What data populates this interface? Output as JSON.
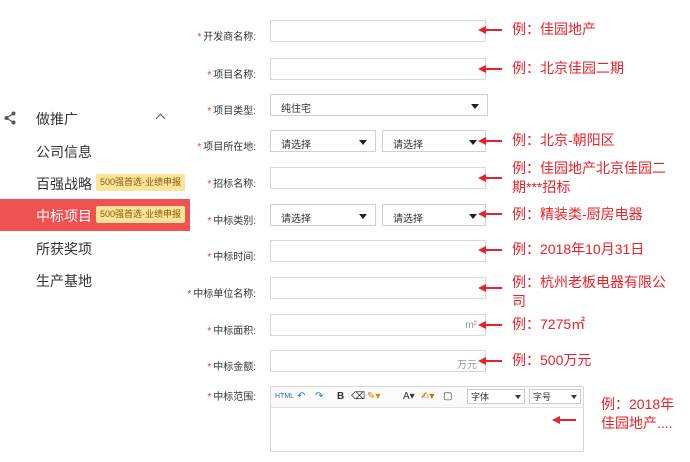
{
  "sidebar": {
    "title": "做推广",
    "items": [
      {
        "label": "公司信息",
        "badge": ""
      },
      {
        "label": "百强战略",
        "badge": "500强首选·业绩申报"
      },
      {
        "label": "中标项目",
        "badge": "500强首选·业绩申报"
      },
      {
        "label": "所获奖项",
        "badge": ""
      },
      {
        "label": "生产基地",
        "badge": ""
      }
    ]
  },
  "form": {
    "required_mark": "*",
    "developer": {
      "label": "开发商名称:",
      "example": "例：佳园地产"
    },
    "project_name": {
      "label": "项目名称:",
      "example": "例：北京佳园二期"
    },
    "project_type": {
      "label": "项目类型:",
      "value": "纯住宅"
    },
    "location": {
      "label": "项目所在地:",
      "select1": "请选择",
      "select2": "请选择",
      "example": "例：北京-朝阳区"
    },
    "tender_name": {
      "label": "招标名称:",
      "example_line1": "例：佳园地产北京佳园二",
      "example_line2": "期***招标"
    },
    "bid_category": {
      "label": "中标类别:",
      "select1": "请选择",
      "select2": "请选择",
      "example": "例：精装类-厨房电器"
    },
    "bid_time": {
      "label": "中标时间:",
      "example": "例：2018年10月31日"
    },
    "bid_unit": {
      "label": "中标单位名称:",
      "example_line1": "例：杭州老板电器有限公",
      "example_line2": "司"
    },
    "bid_area": {
      "label": "中标面积:",
      "unit": "m²",
      "example": "例：7275㎡"
    },
    "bid_amount": {
      "label": "中标金额:",
      "unit": "万元",
      "example": "例：500万元"
    },
    "bid_scope": {
      "label": "中标范围:",
      "example_line1": "例：2018年",
      "example_line2": "佳园地产....",
      "toolbar": {
        "html": "HTML",
        "bold": "B",
        "font_label": "A",
        "font_family": "字体",
        "font_size": "字号"
      }
    }
  },
  "colors": {
    "accent": "#f05252",
    "example_red": "#e8222a",
    "badge_bg": "#fbe39a"
  }
}
